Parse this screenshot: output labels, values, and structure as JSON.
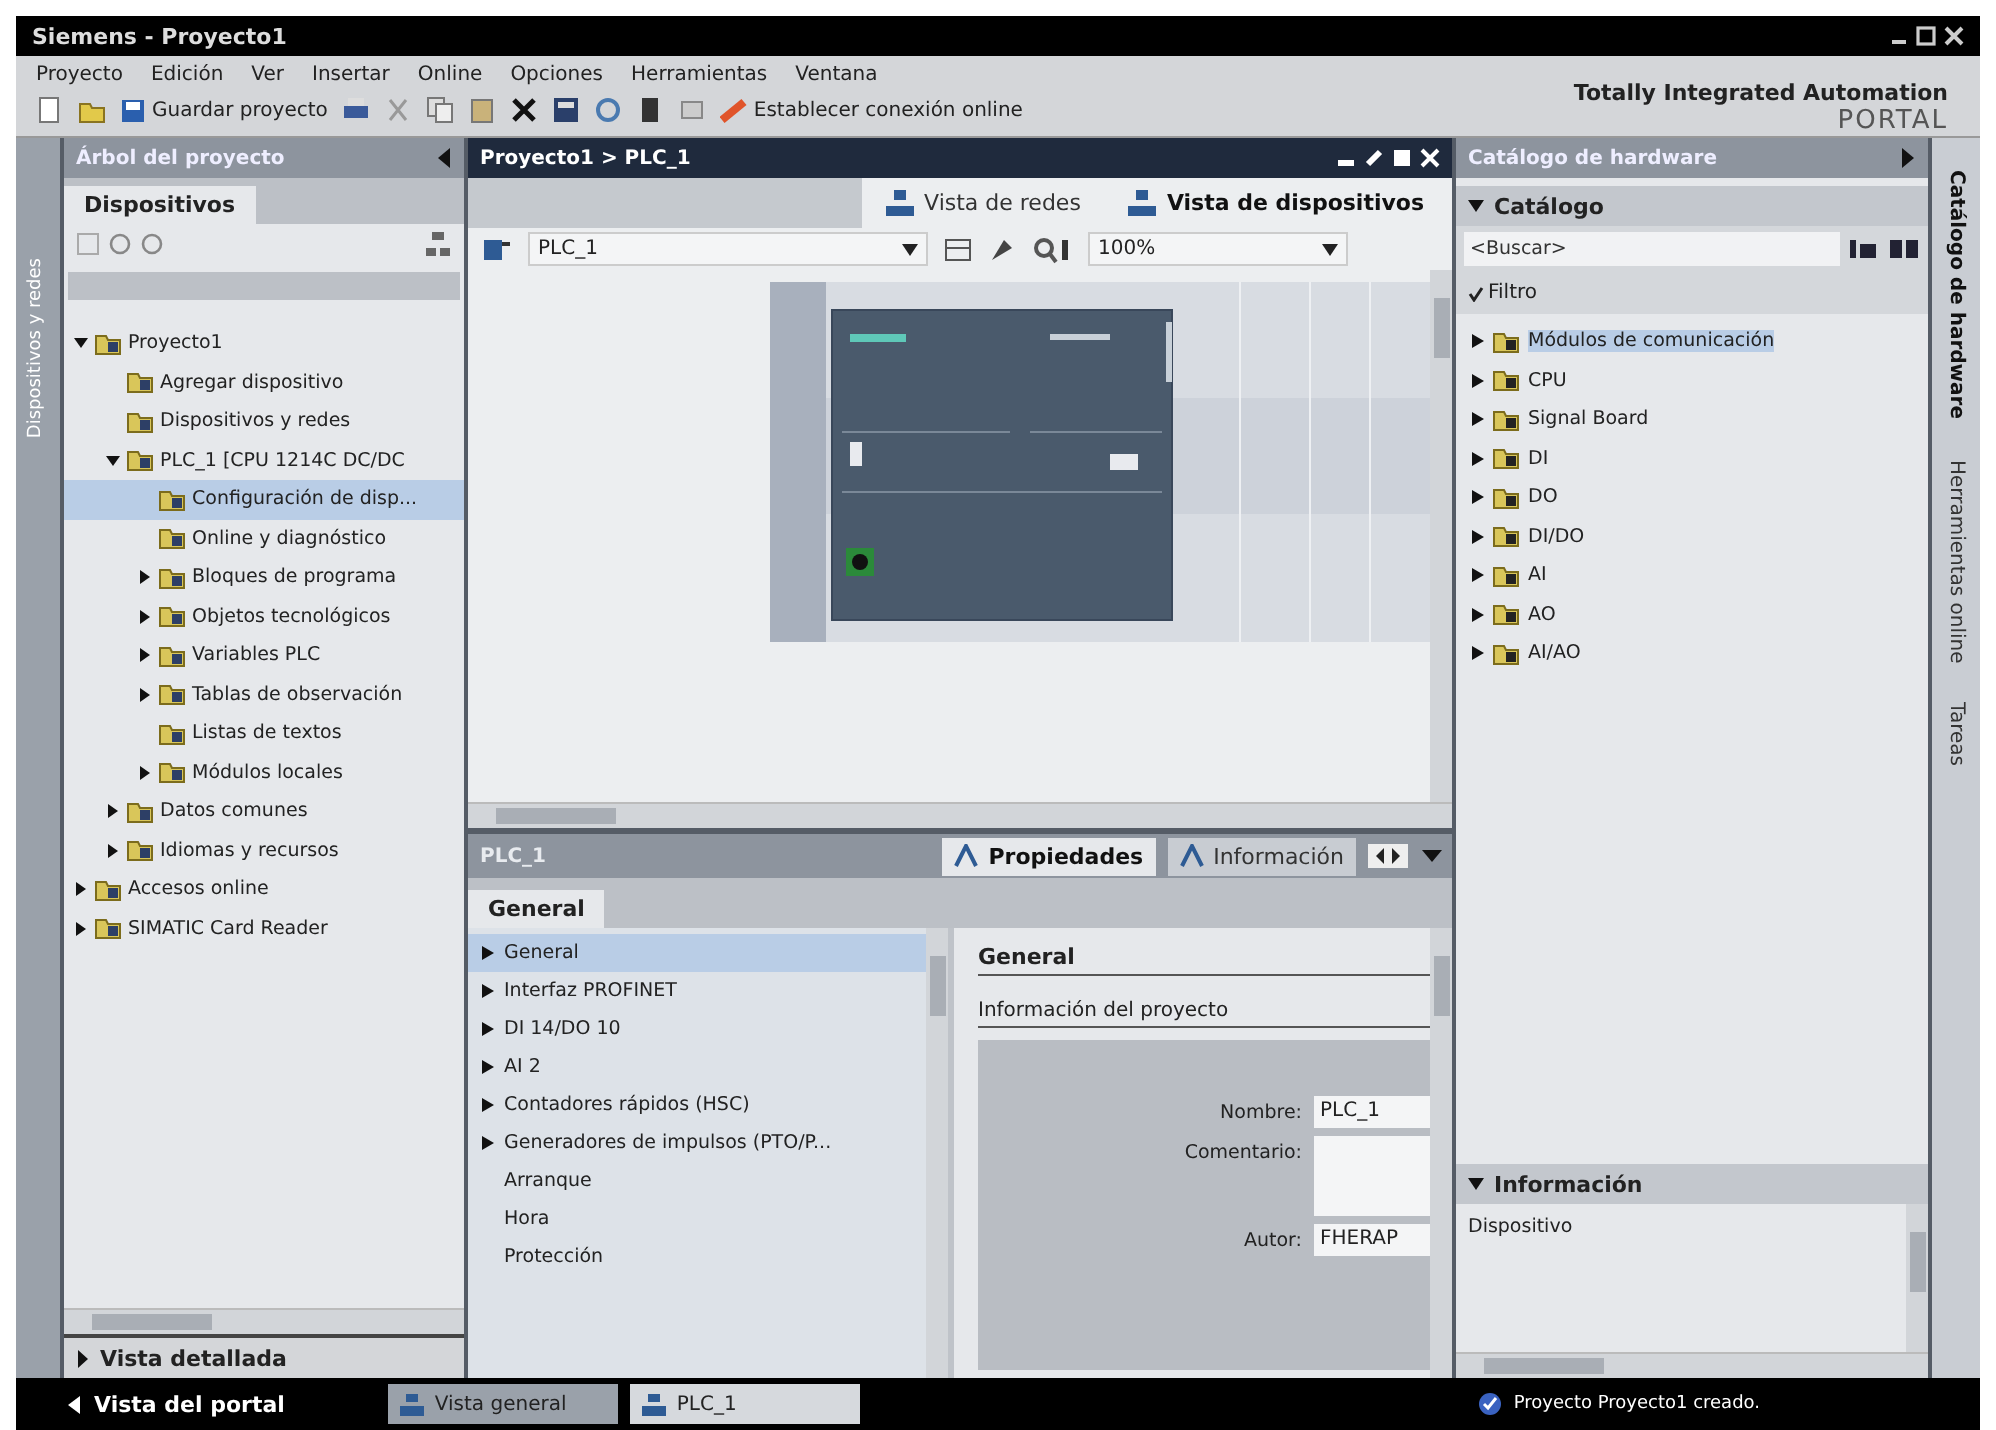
{
  "window": {
    "title": "Siemens - Proyecto1"
  },
  "menu": [
    "Proyecto",
    "Edición",
    "Ver",
    "Insertar",
    "Online",
    "Opciones",
    "Herramientas",
    "Ventana"
  ],
  "toolbar": {
    "save_label": "Guardar proyecto",
    "connect_label": "Establecer conexión online"
  },
  "brand": {
    "line1": "Totally Integrated Automation",
    "line2": "PORTAL"
  },
  "left_strip": {
    "label": "Dispositivos y redes"
  },
  "project_tree": {
    "title": "Árbol del proyecto",
    "tab": "Dispositivos",
    "items": [
      {
        "label": "Proyecto1",
        "expanded": true,
        "selected": false,
        "children": [
          {
            "label": "Agregar dispositivo",
            "selected": false
          },
          {
            "label": "Dispositivos y redes",
            "selected": false
          },
          {
            "label": "PLC_1 [CPU 1214C DC/DC",
            "expanded": true,
            "selected": false,
            "children": [
              {
                "label": "Configuración de disp...",
                "selected": true
              },
              {
                "label": "Online y diagnóstico",
                "selected": false
              },
              {
                "label": "Bloques de programa",
                "expanded": false,
                "selected": false
              },
              {
                "label": "Objetos tecnológicos",
                "expanded": false,
                "selected": false
              },
              {
                "label": "Variables PLC",
                "expanded": false,
                "selected": false
              },
              {
                "label": "Tablas de observación",
                "expanded": false,
                "selected": false
              },
              {
                "label": "Listas de textos",
                "selected": false
              },
              {
                "label": "Módulos locales",
                "expanded": false,
                "selected": false
              }
            ]
          },
          {
            "label": "Datos comunes",
            "expanded": false,
            "selected": false
          },
          {
            "label": "Idiomas y recursos",
            "expanded": false,
            "selected": false
          }
        ]
      },
      {
        "label": "Accesos online",
        "expanded": false,
        "selected": false
      },
      {
        "label": "SIMATIC Card Reader",
        "expanded": false,
        "selected": false
      }
    ],
    "detail_view": "Vista detallada"
  },
  "editor": {
    "title": "Proyecto1 > PLC_1",
    "view_tabs": [
      {
        "label": "Vista de redes",
        "selected": false
      },
      {
        "label": "Vista de dispositivos",
        "selected": true
      }
    ],
    "device": "PLC_1",
    "zoom": "100%"
  },
  "inspector": {
    "object": "PLC_1",
    "tabs": [
      {
        "label": "Propiedades",
        "selected": true
      },
      {
        "label": "Información",
        "selected": false
      }
    ],
    "subtab": "General",
    "nav": [
      {
        "label": "General",
        "expandable": true,
        "selected": true
      },
      {
        "label": "Interfaz PROFINET",
        "expandable": true,
        "selected": false
      },
      {
        "label": "DI 14/DO 10",
        "expandable": true,
        "selected": false
      },
      {
        "label": "AI 2",
        "expandable": true,
        "selected": false
      },
      {
        "label": "Contadores rápidos (HSC)",
        "expandable": true,
        "selected": false
      },
      {
        "label": "Generadores de impulsos (PTO/P...",
        "expandable": true,
        "selected": false
      },
      {
        "label": "Arranque",
        "expandable": false,
        "selected": false
      },
      {
        "label": "Hora",
        "expandable": false,
        "selected": false
      },
      {
        "label": "Protección",
        "expandable": false,
        "selected": false
      }
    ],
    "section": "General",
    "subsection": "Información del proyecto",
    "fields": [
      {
        "label": "Nombre:",
        "value": "PLC_1",
        "kind": "line"
      },
      {
        "label": "Comentario:",
        "kind": "area"
      },
      {
        "label": "Autor:",
        "value": "FHERAP",
        "kind": "line"
      }
    ]
  },
  "catalog": {
    "title": "Catálogo de hardware",
    "section": "Catálogo",
    "search": {
      "placeholder": "<Buscar>"
    },
    "filter": {
      "label": "Filtro",
      "checked": true
    },
    "items": [
      {
        "label": "Módulos de comunicación",
        "selected": true
      },
      {
        "label": "CPU",
        "selected": false
      },
      {
        "label": "Signal Board",
        "selected": false
      },
      {
        "label": "DI",
        "selected": false
      },
      {
        "label": "DO",
        "selected": false
      },
      {
        "label": "DI/DO",
        "selected": false
      },
      {
        "label": "AI",
        "selected": false
      },
      {
        "label": "AO",
        "selected": false
      },
      {
        "label": "AI/AO",
        "selected": false
      }
    ],
    "info_section": "Información",
    "info_text": "Dispositivo"
  },
  "right_tabs": [
    {
      "label": "Catálogo de hardware",
      "selected": true
    },
    {
      "label": "Herramientas online",
      "selected": false
    },
    {
      "label": "Tareas",
      "selected": false
    }
  ],
  "bottom": {
    "portal": "Vista del portal",
    "tasks": [
      {
        "label": "Vista general",
        "selected": true
      },
      {
        "label": "PLC_1",
        "selected": false
      }
    ],
    "status": "Proyecto Proyecto1 creado."
  }
}
